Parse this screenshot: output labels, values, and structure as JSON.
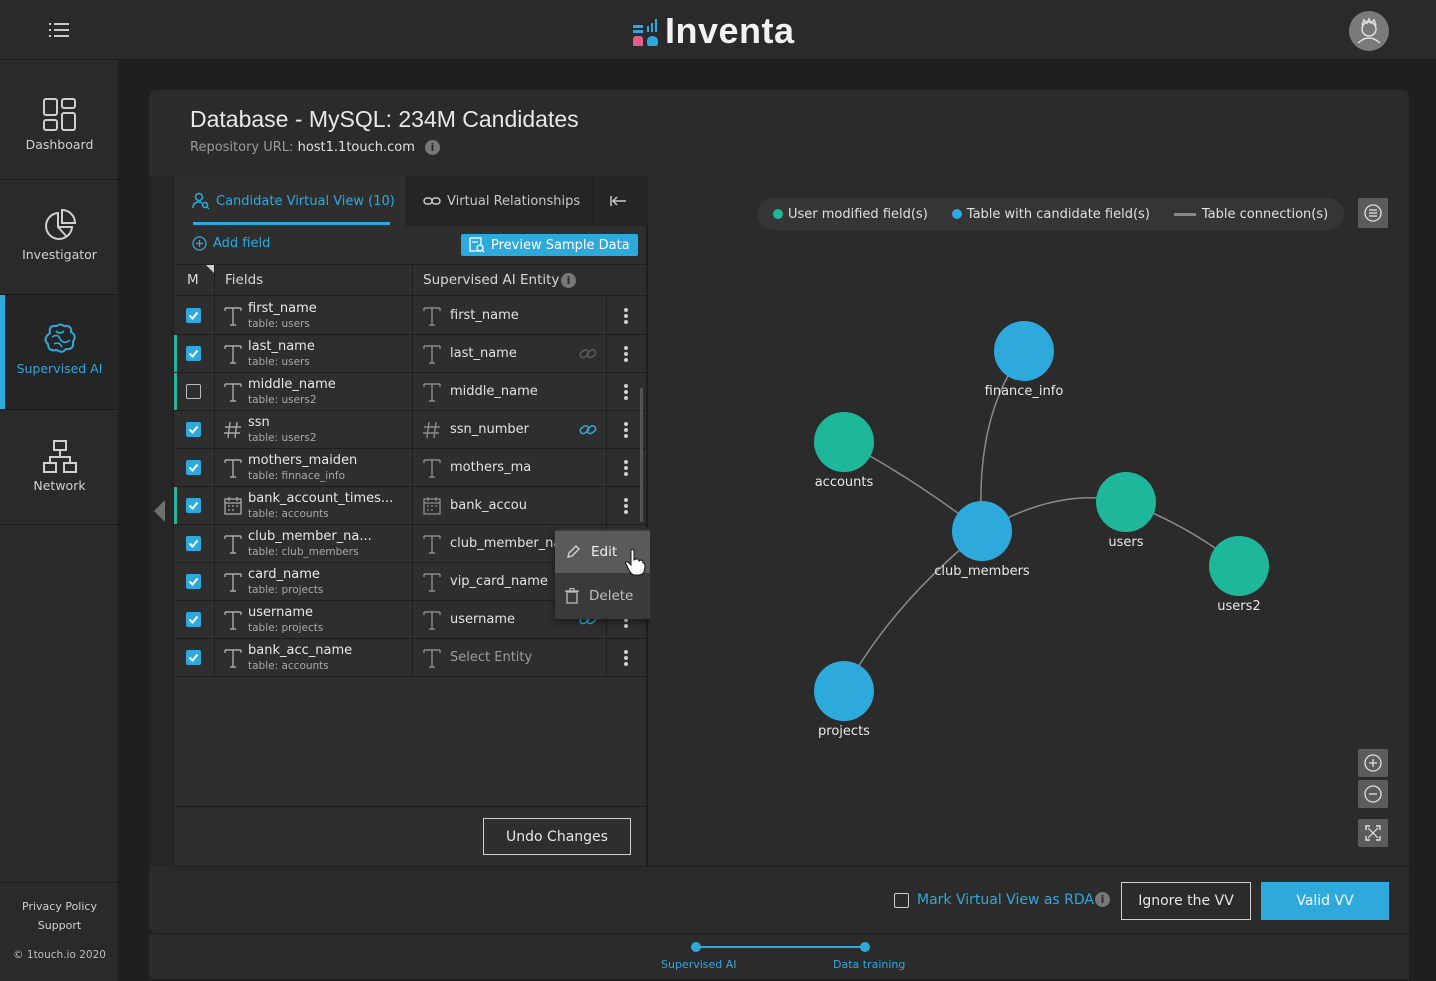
{
  "app": {
    "name": "Inventa"
  },
  "sidebar": {
    "items": [
      {
        "label": "Dashboard",
        "icon": "dashboard-icon"
      },
      {
        "label": "Investigator",
        "icon": "pie-chart-icon"
      },
      {
        "label": "Supervised AI",
        "icon": "brain-icon",
        "active": true
      },
      {
        "label": "Network",
        "icon": "network-icon"
      }
    ],
    "footer": {
      "privacy": "Privacy Policy",
      "support": "Support",
      "copyright": "© 1touch.io 2020"
    }
  },
  "page": {
    "title": "Database - MySQL: 234M Candidates",
    "repo_label": "Repository URL:",
    "repo_url": "host1.1touch.com"
  },
  "tabs": {
    "candidate": "Candidate Virtual View (10)",
    "relationships": "Virtual Relationships",
    "collapse_icon": "collapse-left-icon"
  },
  "toolbar": {
    "add_field": "Add field",
    "preview": "Preview Sample Data"
  },
  "table": {
    "headers": {
      "m": "M",
      "fields": "Fields",
      "entity": "Supervised AI Entity"
    },
    "rows": [
      {
        "field": "first_name",
        "table": "table: users",
        "type": "T",
        "entity": "first_name",
        "checked": true,
        "marked": false,
        "link": ""
      },
      {
        "field": "last_name",
        "table": "table: users",
        "type": "T",
        "entity": "last_name",
        "checked": true,
        "marked": true,
        "link": "dim"
      },
      {
        "field": "middle_name",
        "table": "table: users2",
        "type": "T",
        "entity": "middle_name",
        "checked": false,
        "marked": true,
        "link": ""
      },
      {
        "field": "ssn",
        "table": "table: users2",
        "type": "#",
        "entity": "ssn_number",
        "checked": true,
        "marked": false,
        "link": "blue"
      },
      {
        "field": "mothers_maiden",
        "table": "table: finnace_info",
        "type": "T",
        "entity": "mothers_ma",
        "checked": true,
        "marked": false,
        "link": ""
      },
      {
        "field": "bank_account_times...",
        "table": "table: accounts",
        "type": "date",
        "entity": "bank_accou",
        "checked": true,
        "marked": true,
        "link": ""
      },
      {
        "field": "club_member_na...",
        "table": "table: club_members",
        "type": "T",
        "entity": "club_member_name",
        "checked": true,
        "marked": false,
        "link": ""
      },
      {
        "field": "card_name",
        "table": "table: projects",
        "type": "T",
        "entity": "vip_card_name",
        "checked": true,
        "marked": false,
        "link": ""
      },
      {
        "field": "username",
        "table": "table: projects",
        "type": "T",
        "entity": "username",
        "checked": true,
        "marked": false,
        "link": "blue"
      },
      {
        "field": "bank_acc_name",
        "table": "table: accounts",
        "type": "T",
        "entity": "Select Entity",
        "checked": true,
        "marked": false,
        "link": "",
        "placeholder": true
      }
    ]
  },
  "context_menu": {
    "edit": "Edit",
    "delete": "Delete"
  },
  "undo": "Undo Changes",
  "legend": {
    "user_modified": "User modified field(s)",
    "table_candidate": "Table with candidate field(s)",
    "table_connection": "Table connection(s)"
  },
  "graph": {
    "nodes": [
      {
        "id": "finance_info",
        "label": "finance_info",
        "kind": "candidate"
      },
      {
        "id": "accounts",
        "label": "accounts",
        "kind": "modified"
      },
      {
        "id": "club_members",
        "label": "club_members",
        "kind": "candidate"
      },
      {
        "id": "users",
        "label": "users",
        "kind": "modified"
      },
      {
        "id": "users2",
        "label": "users2",
        "kind": "modified"
      },
      {
        "id": "projects",
        "label": "projects",
        "kind": "candidate"
      }
    ],
    "edges": [
      [
        "club_members",
        "finance_info"
      ],
      [
        "club_members",
        "accounts"
      ],
      [
        "club_members",
        "users"
      ],
      [
        "users",
        "users2"
      ],
      [
        "club_members",
        "projects"
      ]
    ]
  },
  "footer_actions": {
    "rda": "Mark Virtual View as RDA",
    "ignore": "Ignore the VV",
    "valid": "Valid VV"
  },
  "stepper": {
    "step1": "Supervised AI",
    "step2": "Data training"
  },
  "colors": {
    "accent": "#2ea9dc",
    "modified": "#1fb79a",
    "candidate": "#2ea9dc"
  }
}
